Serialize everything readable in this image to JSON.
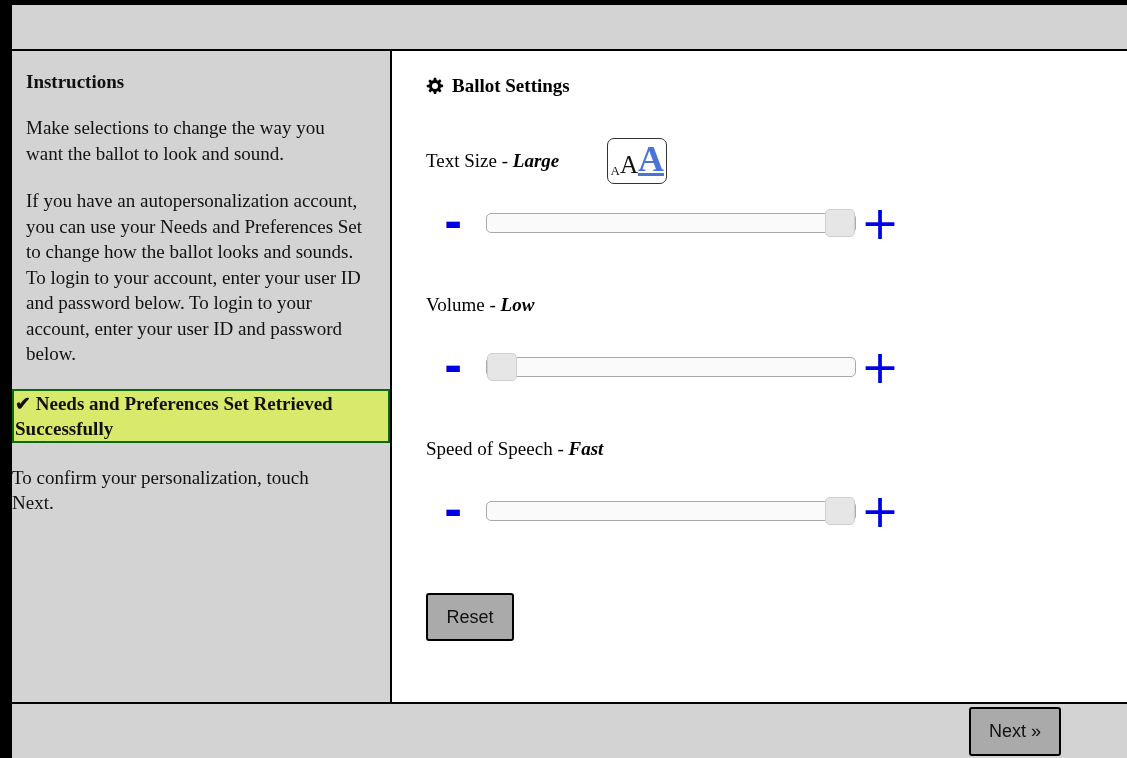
{
  "sidebar": {
    "heading": "Instructions",
    "paragraphs": [
      "Make selections to change the way you want the ballot to look and sound.",
      "If you have an autopersonalization account, you can use your Needs and Preferences Set to change how the ballot looks and sounds. To login to your account, enter your user ID and password below. To login to your account, enter your user ID and password below."
    ],
    "status": {
      "icon": "✔",
      "text": "Needs and Preferences Set Retrieved Successfully"
    },
    "confirm": "To confirm your personalization, touch Next."
  },
  "settings": {
    "title": "Ballot Settings",
    "text_size_button": [
      "A",
      "A",
      "A"
    ],
    "sliders": [
      {
        "label": "Text Size - ",
        "value": "Large",
        "minus": "-",
        "plus": "+",
        "level": 1
      },
      {
        "label": "Volume - ",
        "value": "Low",
        "minus": "-",
        "plus": "+",
        "level": 0
      },
      {
        "label": "Speed of Speech - ",
        "value": "Fast",
        "minus": "-",
        "plus": "+",
        "level": 1
      }
    ],
    "reset": "Reset"
  },
  "footer": {
    "next": "Next »"
  }
}
